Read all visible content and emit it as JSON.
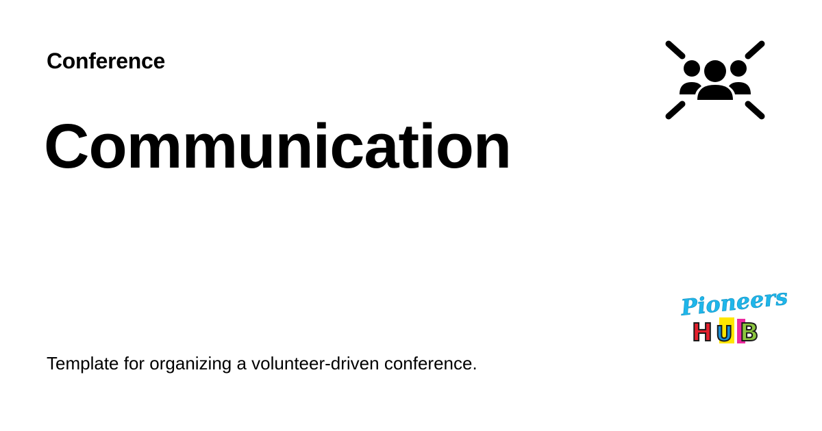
{
  "card": {
    "category": "Conference",
    "title": "Communication",
    "description": "Template for organizing a volunteer-driven conference."
  },
  "icon": {
    "name": "groups-icon",
    "color": "#000000"
  },
  "logo": {
    "name": "pioneers-hub-logo",
    "text_top": "Pioneers",
    "text_bottom": "HUB",
    "colors": {
      "script": "#1fb6ea",
      "h": "#e5202d",
      "u": "#1a8fd6",
      "b": "#8cc63f",
      "accent_yellow": "#ffe600",
      "accent_pink": "#ec2aa0",
      "outline": "#1a1a1a"
    }
  }
}
